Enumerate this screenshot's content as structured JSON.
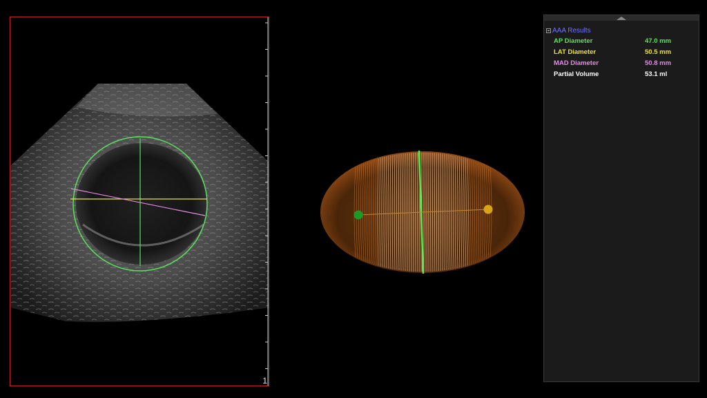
{
  "viewport": {
    "frame_number": "1"
  },
  "results": {
    "header": "AAA Results",
    "rows": [
      {
        "label": "AP Diameter",
        "value": "47.0 mm",
        "color": "#58e35a"
      },
      {
        "label": "LAT Diameter",
        "value": "50.5 mm",
        "color": "#e8e33d"
      },
      {
        "label": "MAD Diameter",
        "value": "50.8 mm",
        "color": "#e58be6"
      },
      {
        "label": "Partial Volume",
        "value": "53.1 ml",
        "color": "#ffffff"
      }
    ]
  },
  "colors": {
    "viewport_border": "#c42323",
    "ap_line": "#58e35a",
    "lat_line": "#e8e33d",
    "mad_line": "#e58be6",
    "header_text": "#6f74ff",
    "mesh": "#e07a26"
  }
}
